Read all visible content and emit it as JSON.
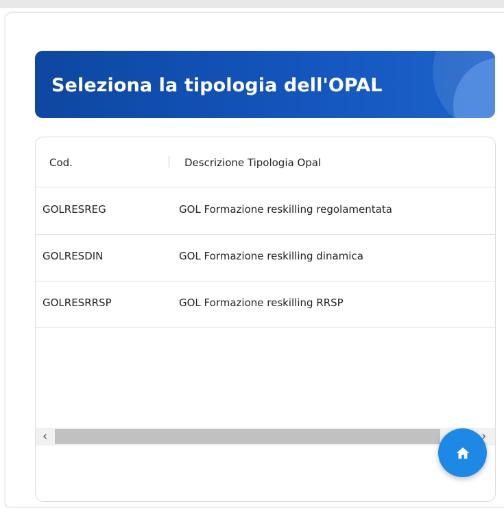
{
  "banner": {
    "title": "Seleziona la tipologia dell'OPAL"
  },
  "table": {
    "columns": [
      "Cod.",
      "Descrizione Tipologia Opal"
    ],
    "rows": [
      [
        "GOLRESREG",
        "GOL Formazione reskilling regolamentata"
      ],
      [
        "GOLRESDIN",
        "GOL Formazione reskilling dinamica"
      ],
      [
        "GOLRESRRSP",
        "GOL Formazione reskilling RRSP"
      ]
    ]
  },
  "scrollbar": {
    "left_arrow": "‹",
    "right_arrow": "›"
  },
  "fab": {
    "icon": "home-icon"
  },
  "colors": {
    "banner": "#0d47a1",
    "fab": "#1e88e5"
  }
}
